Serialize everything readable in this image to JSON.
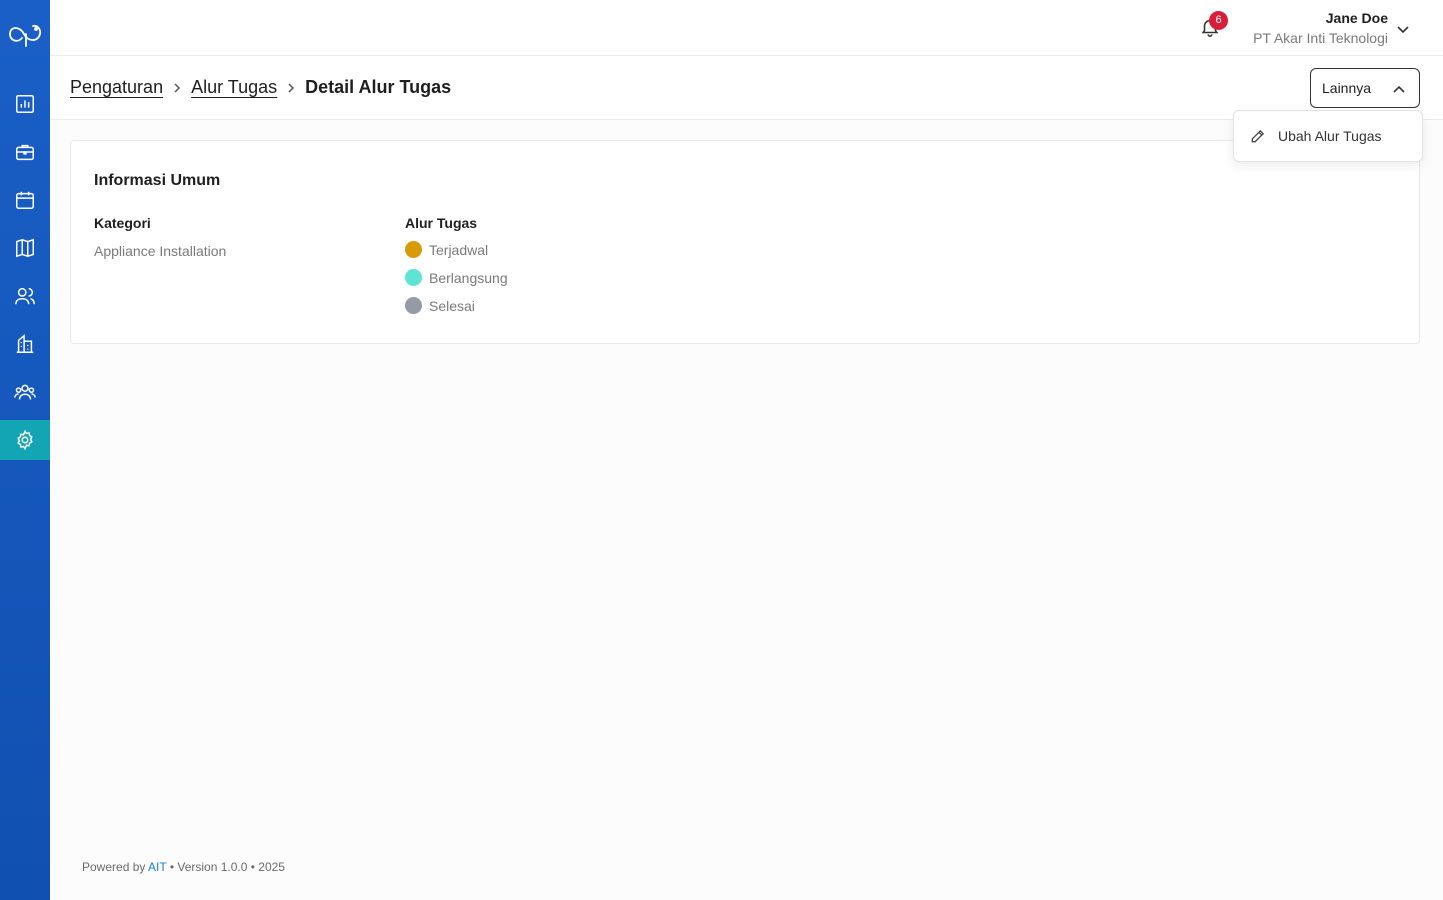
{
  "header": {
    "notification_count": "6",
    "user_name": "Jane Doe",
    "user_org": "PT Akar Inti Teknologi"
  },
  "sidebar": {
    "items": [
      {
        "icon": "bar-chart-icon"
      },
      {
        "icon": "briefcase-icon"
      },
      {
        "icon": "calendar-icon"
      },
      {
        "icon": "map-icon"
      },
      {
        "icon": "users-icon"
      },
      {
        "icon": "building-icon"
      },
      {
        "icon": "team-icon"
      },
      {
        "icon": "gear-icon",
        "active": true
      }
    ]
  },
  "breadcrumb": {
    "items": [
      "Pengaturan",
      "Alur Tugas"
    ],
    "current": "Detail Alur Tugas"
  },
  "actions": {
    "more_label": "Lainnya",
    "menu": [
      {
        "label": "Ubah Alur Tugas",
        "icon": "pencil-icon"
      }
    ]
  },
  "card": {
    "title": "Informasi Umum",
    "category_label": "Kategori",
    "category_value": "Appliance Installation",
    "workflow_label": "Alur Tugas",
    "statuses": [
      {
        "label": "Terjadwal",
        "color": "#d99a0a"
      },
      {
        "label": "Berlangsung",
        "color": "#5fe3d6"
      },
      {
        "label": "Selesai",
        "color": "#949aa6"
      }
    ]
  },
  "footer": {
    "prefix": "Powered by ",
    "brand": "AIT",
    "suffix": " • Version 1.0.0 • 2025"
  },
  "colors": {
    "sidebar": "#1a5fc7",
    "active_nav": "#13a5b3",
    "badge": "#d81e3a"
  }
}
